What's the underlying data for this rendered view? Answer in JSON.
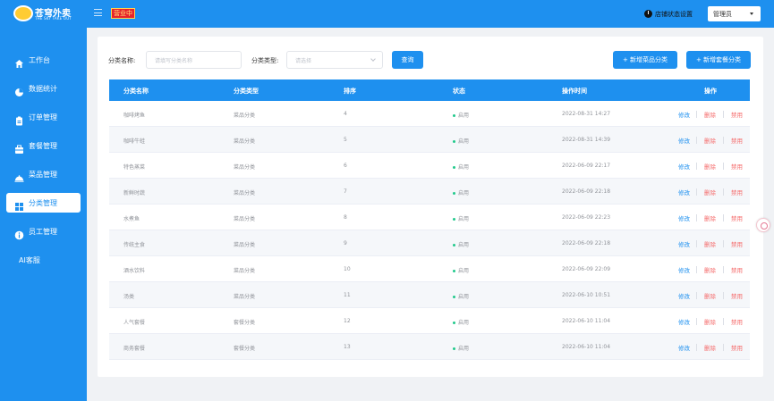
{
  "app": {
    "logo_text": "苍穹外卖",
    "logo_sub": "THE SKY TAKE OUT",
    "status_badge": "营业中"
  },
  "header": {
    "shop_setting": "店铺状态设置",
    "admin_label": "管理员"
  },
  "sidebar": {
    "items": [
      {
        "label": "工作台",
        "icon": "home-icon"
      },
      {
        "label": "数据统计",
        "icon": "chart-icon"
      },
      {
        "label": "订单管理",
        "icon": "clipboard-icon"
      },
      {
        "label": "套餐管理",
        "icon": "package-icon"
      },
      {
        "label": "菜品管理",
        "icon": "dish-icon"
      },
      {
        "label": "分类管理",
        "icon": "grid-icon"
      },
      {
        "label": "员工管理",
        "icon": "info-icon"
      },
      {
        "label": "AI客服",
        "icon": ""
      }
    ],
    "active_index": 5
  },
  "filters": {
    "name_label": "分类名称:",
    "name_placeholder": "请填写分类名称",
    "type_label": "分类类型:",
    "type_placeholder": "请选择",
    "query_button": "查询",
    "add_dish_category": "+ 新增菜品分类",
    "add_setmeal_category": "+ 新增套餐分类"
  },
  "table": {
    "headers": [
      "分类名称",
      "分类类型",
      "排序",
      "状态",
      "操作时间",
      "操作"
    ],
    "actions": {
      "edit": "修改",
      "delete": "删除",
      "disable": "禁用"
    },
    "rows": [
      {
        "name": "咖啡烤鱼",
        "type": "菜品分类",
        "sort": "4",
        "status": "启用",
        "time": "2022-08-31 14:27"
      },
      {
        "name": "咖啡牛蛙",
        "type": "菜品分类",
        "sort": "5",
        "status": "启用",
        "time": "2022-08-31 14:39"
      },
      {
        "name": "特色蒸菜",
        "type": "菜品分类",
        "sort": "6",
        "status": "启用",
        "time": "2022-06-09 22:17"
      },
      {
        "name": "新鲜时蔬",
        "type": "菜品分类",
        "sort": "7",
        "status": "启用",
        "time": "2022-06-09 22:18"
      },
      {
        "name": "水煮鱼",
        "type": "菜品分类",
        "sort": "8",
        "status": "启用",
        "time": "2022-06-09 22:23"
      },
      {
        "name": "传统主食",
        "type": "菜品分类",
        "sort": "9",
        "status": "启用",
        "time": "2022-06-09 22:18"
      },
      {
        "name": "酒水饮料",
        "type": "菜品分类",
        "sort": "10",
        "status": "启用",
        "time": "2022-06-09 22:09"
      },
      {
        "name": "汤类",
        "type": "菜品分类",
        "sort": "11",
        "status": "启用",
        "time": "2022-06-10 10:51"
      },
      {
        "name": "人气套餐",
        "type": "套餐分类",
        "sort": "12",
        "status": "启用",
        "time": "2022-06-10 11:04"
      },
      {
        "name": "商务套餐",
        "type": "套餐分类",
        "sort": "13",
        "status": "启用",
        "time": "2022-06-10 11:04"
      }
    ]
  },
  "colors": {
    "primary": "#1e90ef",
    "status_badge_bg": "#e8232c",
    "danger": "#f56c6c",
    "status_dot": "#20c98b"
  }
}
